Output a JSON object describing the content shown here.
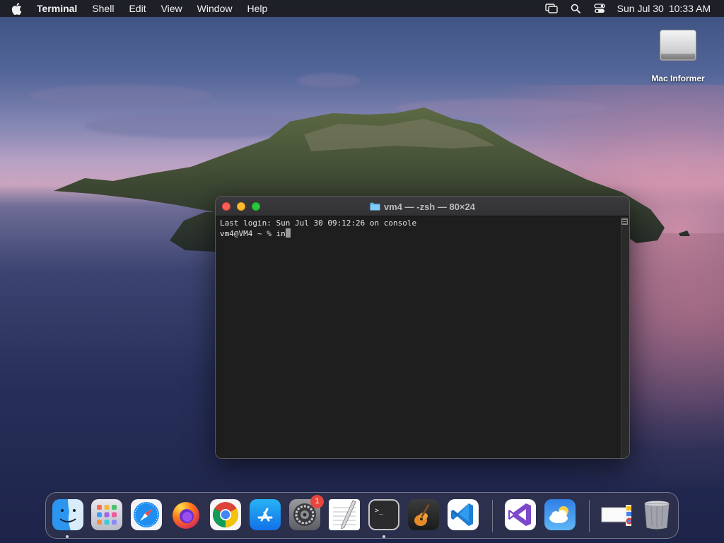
{
  "menubar": {
    "app_name": "Terminal",
    "items": [
      "Shell",
      "Edit",
      "View",
      "Window",
      "Help"
    ],
    "date": "Sun Jul 30",
    "time": "10:33 AM"
  },
  "desktop": {
    "icons": [
      {
        "label": "Mac Informer",
        "icon": "external-drive-icon"
      }
    ]
  },
  "terminal": {
    "title": "vm4 — -zsh — 80×24",
    "lines": [
      "Last login: Sun Jul 30 09:12:26 on console"
    ],
    "prompt": "vm4@VM4 ~ % ",
    "input": "in"
  },
  "dock": {
    "apps": [
      {
        "name": "Finder",
        "icon": "finder-icon",
        "running": true
      },
      {
        "name": "Launchpad",
        "icon": "launchpad-icon",
        "running": false
      },
      {
        "name": "Safari",
        "icon": "safari-icon",
        "running": false
      },
      {
        "name": "Firefox",
        "icon": "firefox-icon",
        "running": false
      },
      {
        "name": "Chrome",
        "icon": "chrome-icon",
        "running": false
      },
      {
        "name": "App Store",
        "icon": "app-store-icon",
        "running": false
      },
      {
        "name": "System Preferences",
        "icon": "system-preferences-icon",
        "running": false,
        "badge": "1"
      },
      {
        "name": "TextEdit",
        "icon": "textedit-icon",
        "running": false
      },
      {
        "name": "Terminal",
        "icon": "terminal-icon",
        "running": true
      },
      {
        "name": "GarageBand",
        "icon": "garageband-icon",
        "running": false
      },
      {
        "name": "Visual Studio Code",
        "icon": "vscode-icon",
        "running": false
      },
      {
        "name": "Visual Studio",
        "icon": "visual-studio-icon",
        "running": false
      },
      {
        "name": "Weather",
        "icon": "weather-icon",
        "running": false
      },
      {
        "name": "Chrome Apps Folder",
        "icon": "folder-stack-icon",
        "running": false
      },
      {
        "name": "Trash",
        "icon": "trash-icon",
        "running": false
      }
    ]
  }
}
